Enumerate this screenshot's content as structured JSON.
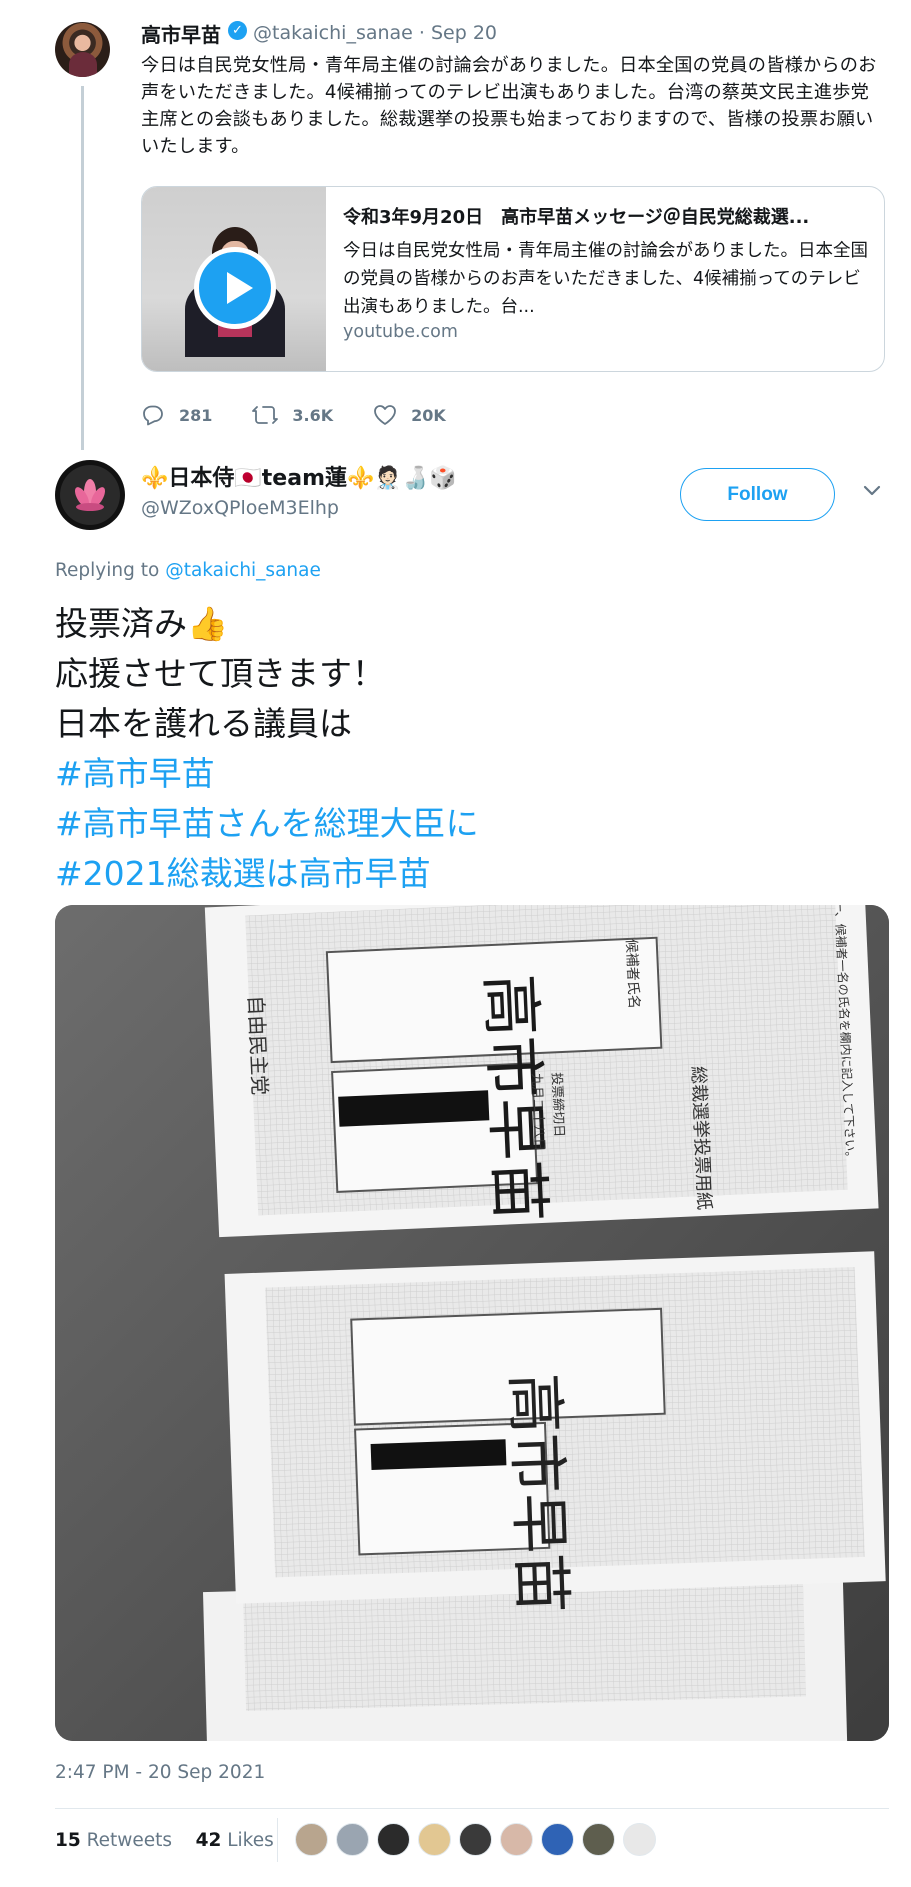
{
  "parent_tweet": {
    "author_name": "高市早苗",
    "verified_icon": "✓",
    "handle_date": "@takaichi_sanae · Sep 20",
    "text": "今日は自民党女性局・青年局主催の討論会がありました。日本全国の党員の皆様からのお声をいただきました。4候補揃ってのテレビ出演もありました。台湾の蔡英文民主進歩党主席との会談もありました。総裁選挙の投票も始まっておりますので、皆様の投票お願いいたします。",
    "card": {
      "title": "令和3年9月20日　高市早苗メッセージ＠自民党総裁選...",
      "description": "今日は自民党女性局・青年局主催の討論会がありました。日本全国の党員の皆様からのお声をいただきました、4候補揃ってのテレビ出演もありました。台...",
      "domain": "youtube.com"
    },
    "actions": {
      "replies": "281",
      "retweets": "3.6K",
      "likes": "20K"
    }
  },
  "reply_tweet": {
    "display_name": "⚜️日本侍🇯🇵team蓮⚜️🧑🏻‍⚕️🍶🎲",
    "handle": "@WZoxQPloeM3Elhp",
    "follow_label": "Follow",
    "replying_prefix": "Replying to ",
    "replying_to": "@takaichi_sanae",
    "lines": [
      "投票済み👍",
      "応援させて頂きます！",
      "日本を護れる議員は"
    ],
    "hashtags": [
      "#高市早苗",
      "#高市早苗さんを総理大臣に",
      "#2021総裁選は高市早苗"
    ],
    "photo": {
      "ballot_party": "自由民主党",
      "ballot_title": "総裁選挙投票用紙",
      "ballot_candidate_label": "候補者氏名",
      "ballot_handwritten": "高市早苗",
      "ballot_deadline": "投票締切日",
      "ballot_date": "九月二十八日",
      "ballot_instruction": "一、候補者一名の氏名を欄内に記入して下さい。"
    },
    "timestamp": "2:47 PM - 20 Sep 2021",
    "retweets_count": "15",
    "retweets_label": " Retweets",
    "likes_count": "42",
    "likes_label": " Likes"
  },
  "colors": {
    "accent": "#1da1f2",
    "muted_text": "#657786",
    "border": "#e1e8ed",
    "thread_line": "#c4cfd6"
  },
  "icons": [
    "verified-icon",
    "reply-icon",
    "retweet-icon",
    "like-icon",
    "play-icon",
    "chevron-down-icon",
    "lotus-icon"
  ]
}
